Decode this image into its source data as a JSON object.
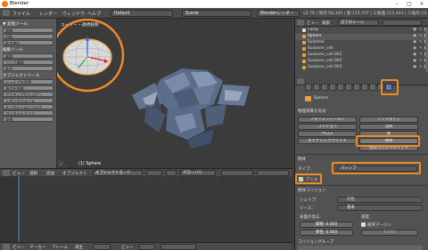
{
  "window": {
    "title": "Blender"
  },
  "infobar": {
    "menus": [
      "ファイル",
      "レンダー",
      "ウィンドウ",
      "ヘルプ"
    ],
    "screen_layout": "Default",
    "scene": "Scene",
    "render_engine": "Blenderレンダー",
    "stats": "v2.79 | 頂点:58,345 | 面:115,707 | 三角面:115,403 | 三角形:10,409 | オブ"
  },
  "toolshelf": {
    "transform_header": "▼ 変換ツール",
    "transform": [
      "移動",
      "回転",
      "拡大縮小"
    ],
    "edit_header": "編集ツール",
    "edit": [
      "複製",
      "リンク複製",
      "結合"
    ],
    "section_label": "オブジェクトツール",
    "tools": [
      "シェイプを変更",
      "頂点を削除",
      "アクティブからコピー",
      "トランスフォーム",
      "キーフレームにベイク",
      "コンストレイント",
      "詳細"
    ]
  },
  "viewport": {
    "view_label": "ユーザー・透視投影",
    "object_label": "(1) Sphere"
  },
  "vp_header": {
    "view": "ビュー",
    "select": "選択",
    "add": "追加",
    "object": "オブジェクト",
    "mode": "オブジェクトモード",
    "pivot": "グローバル"
  },
  "tl_header": {
    "view": "ビュー",
    "marker": "マーカー",
    "frame": "フレーム",
    "play": "再生",
    "view2": "ビュー"
  },
  "outliner": {
    "view": "ビュー",
    "search": "検索",
    "scene_filter": "全てのシーン",
    "rows": [
      "Lamp",
      "Sphere",
      "Suzanne",
      "Suzanne_cell",
      "Suzanne_cell.001",
      "Suzanne_cell.002",
      "Suzanne_cell.003"
    ]
  },
  "properties": {
    "object_name": "Sphere",
    "section_title": "物理演算を有効",
    "physics_buttons": [
      [
        "フォースフィールド",
        "ソフトボディ"
      ],
      [
        "コリジョン",
        "流体"
      ],
      [
        "クロス",
        "煙"
      ],
      [
        "ダイナミックペイント",
        "剛体"
      ],
      [
        "",
        "剛体コンストレイント"
      ]
    ],
    "rigid_body_header": "剛体",
    "type_label": "タイプ:",
    "type_value": "パッシブ",
    "animated_label": "アニメ",
    "collision_header": "剛体コリジョン",
    "shape_label": "シェイプ:",
    "shape_value": "凸包",
    "source_label": "ソース:",
    "source_value": "基本",
    "surface_label": "表面の反応:",
    "sensitivity_label": "感度:",
    "friction_label": "摩擦:",
    "friction_value": "0.500",
    "margin_label": "衝突マージン",
    "bounce_label": "弾性:",
    "bounce_value": "0.000",
    "margin_value": "0.040",
    "groups_label": "コリジョングループ"
  },
  "accent_color": "#f08a24"
}
